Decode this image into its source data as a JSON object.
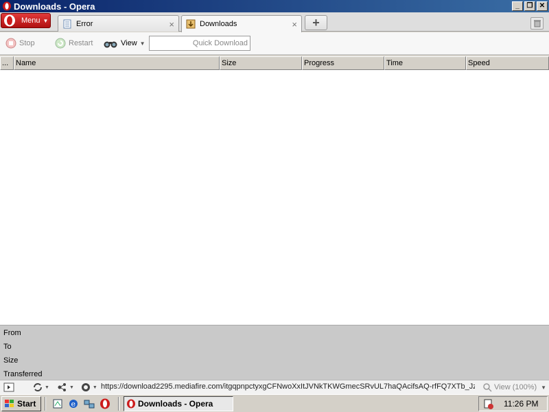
{
  "window": {
    "title": "Downloads - Opera",
    "buttons": {
      "minimize": "_",
      "maximize": "❐",
      "close": "✕"
    }
  },
  "tabbar": {
    "menu_label": "Menu",
    "tabs": [
      {
        "label": "Error",
        "active": false
      },
      {
        "label": "Downloads",
        "active": true
      }
    ],
    "new_tab": "+",
    "close_glyph": "×"
  },
  "toolbar": {
    "stop_label": "Stop",
    "restart_label": "Restart",
    "view_label": "View",
    "quick_download_placeholder": "Quick Download"
  },
  "columns": [
    "...",
    "Name",
    "Size",
    "Progress",
    "Time",
    "Speed"
  ],
  "downloads": [],
  "details": {
    "from_label": "From",
    "to_label": "To",
    "size_label": "Size",
    "transferred_label": "Transferred"
  },
  "statusbar": {
    "url": "https://download2295.mediafire.com/itgqpnpctyxgCFNwoXxItJVNkTKWGmecSRvUL7haQAcifsAQ-rfFQ7XTb_Jz...",
    "zoom": "View (100%)"
  },
  "taskbar": {
    "start_label": "Start",
    "task_label": "Downloads - Opera",
    "clock": "11:26 PM"
  },
  "colors": {
    "titlebar": "#0a246a",
    "opera_red": "#cc1b1b",
    "detail_panel": "#c9c9c9"
  }
}
